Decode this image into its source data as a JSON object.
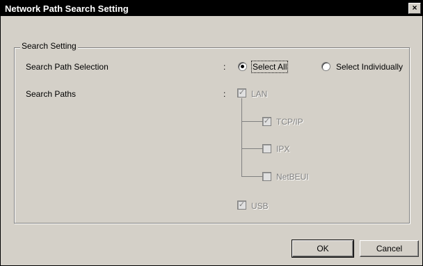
{
  "window": {
    "title": "Network Path Search Setting",
    "close_glyph": "×"
  },
  "group": {
    "legend": "Search Setting"
  },
  "search_path_selection": {
    "label": "Search Path Selection",
    "colon": ":",
    "options": [
      {
        "label": "Select All",
        "selected": true
      },
      {
        "label": "Select Individually",
        "selected": false
      }
    ]
  },
  "search_paths": {
    "label": "Search Paths",
    "colon": ":",
    "items": [
      {
        "label": "LAN",
        "checked": true,
        "enabled": false
      },
      {
        "label": "TCP/IP",
        "checked": true,
        "enabled": false
      },
      {
        "label": "IPX",
        "checked": false,
        "enabled": false
      },
      {
        "label": "NetBEUI",
        "checked": false,
        "enabled": false
      },
      {
        "label": "USB",
        "checked": true,
        "enabled": false
      }
    ]
  },
  "buttons": {
    "ok": "OK",
    "cancel": "Cancel"
  },
  "check_glyph": "✓"
}
